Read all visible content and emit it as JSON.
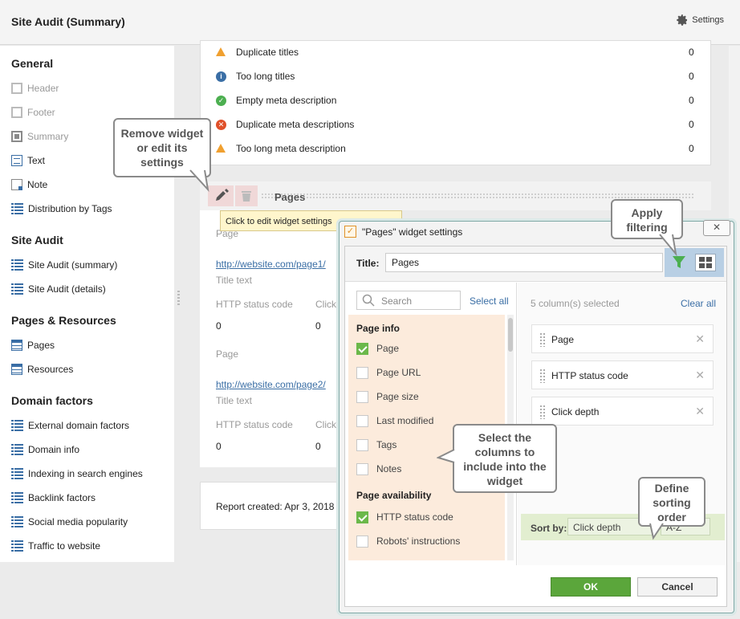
{
  "app": {
    "title": "Site Audit (Summary)",
    "settings_label": "Settings"
  },
  "sidebar": {
    "sections": [
      {
        "heading": "General",
        "items": [
          "Header",
          "Footer",
          "Summary",
          "Text",
          "Note",
          "Distribution by Tags"
        ]
      },
      {
        "heading": "Site Audit",
        "items": [
          "Site Audit (summary)",
          "Site Audit (details)"
        ]
      },
      {
        "heading": "Pages & Resources",
        "items": [
          "Pages",
          "Resources"
        ]
      },
      {
        "heading": "Domain factors",
        "items": [
          "External domain factors",
          "Domain info",
          "Indexing in search engines",
          "Backlink factors",
          "Social media popularity",
          "Traffic to website"
        ]
      }
    ]
  },
  "issues": [
    {
      "label": "Duplicate titles",
      "value": "0",
      "status": "warning"
    },
    {
      "label": "Too long titles",
      "value": "0",
      "status": "info"
    },
    {
      "label": "Empty meta description",
      "value": "0",
      "status": "ok"
    },
    {
      "label": "Duplicate meta descriptions",
      "value": "0",
      "status": "error"
    },
    {
      "label": "Too long meta description",
      "value": "0",
      "status": "warning"
    }
  ],
  "widget": {
    "title": "Pages",
    "tooltip": "Click to edit widget settings",
    "header_partial": "Page",
    "pages": [
      {
        "link": "http://website.com/page1/",
        "title_label": "Title text",
        "status_label": "HTTP status code",
        "status_value": "0",
        "click_label": "Click",
        "click_value": "0",
        "page_label": "Page"
      },
      {
        "link": "http://website.com/page2/",
        "title_label": "Title text",
        "status_label": "HTTP status code",
        "status_value": "0",
        "click_label": "Click",
        "click_value": "0"
      }
    ],
    "report_created": "Report created: Apr 3, 2018"
  },
  "callouts": {
    "remove": "Remove widget or edit its settings",
    "filter": "Apply filtering",
    "columns": "Select the columns to include into the widget",
    "sorting": "Define sorting order"
  },
  "dialog": {
    "title": "\"Pages\" widget settings",
    "close": "✕",
    "title_label": "Title:",
    "title_value": "Pages",
    "search_placeholder": "Search",
    "select_all": "Select all",
    "selected_count": "5 column(s) selected",
    "clear_all": "Clear all",
    "groups": [
      {
        "name": "Page info",
        "fields": [
          {
            "label": "Page",
            "checked": true
          },
          {
            "label": "Page URL",
            "checked": false
          },
          {
            "label": "Page size",
            "checked": false
          },
          {
            "label": "Last modified",
            "checked": false
          },
          {
            "label": "Tags",
            "checked": false
          },
          {
            "label": "Notes",
            "checked": false
          }
        ]
      },
      {
        "name": "Page availability",
        "fields": [
          {
            "label": "HTTP status code",
            "checked": true
          },
          {
            "label": "Robots' instructions",
            "checked": false
          }
        ]
      }
    ],
    "selected_columns": [
      "Page",
      "HTTP status code",
      "Click depth"
    ],
    "sort_label": "Sort by:",
    "sort_field": "Click depth",
    "sort_order": "A-Z",
    "ok": "OK",
    "cancel": "Cancel"
  },
  "colors": {
    "ok_green": "#5ba63b",
    "warning": "#f0a030",
    "info": "#3a6ea5",
    "error": "#e0502a",
    "success": "#4caf50"
  }
}
